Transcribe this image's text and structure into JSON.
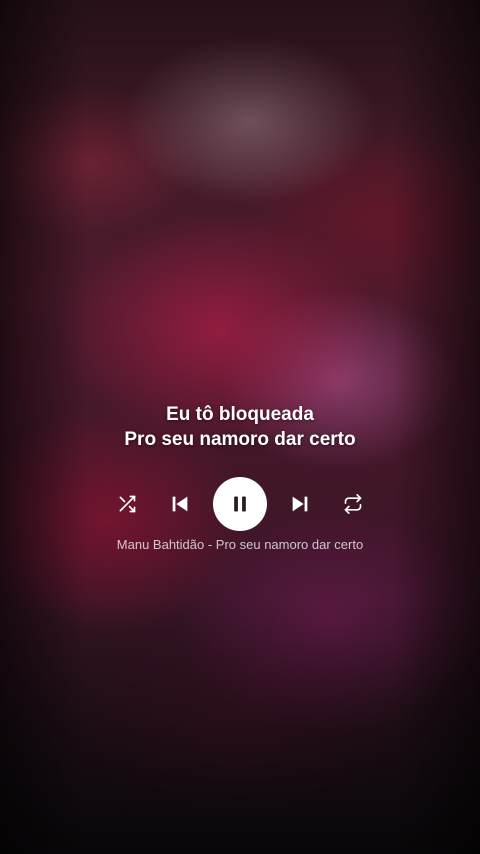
{
  "lyrics": {
    "line1": "Eu tô bloqueada",
    "line2": "Pro seu namoro dar certo"
  },
  "player": {
    "controls": {
      "shuffle_icon": "shuffle-icon",
      "previous_icon": "skip-previous-icon",
      "play_state_icon": "pause-icon",
      "next_icon": "skip-next-icon",
      "repeat_icon": "repeat-icon"
    },
    "track_info": "Manu Bahtidão - Pro seu namoro dar certo"
  },
  "colors": {
    "text": "#ffffff",
    "button_bg": "#ffffff",
    "button_icon": "#2a1a22"
  }
}
